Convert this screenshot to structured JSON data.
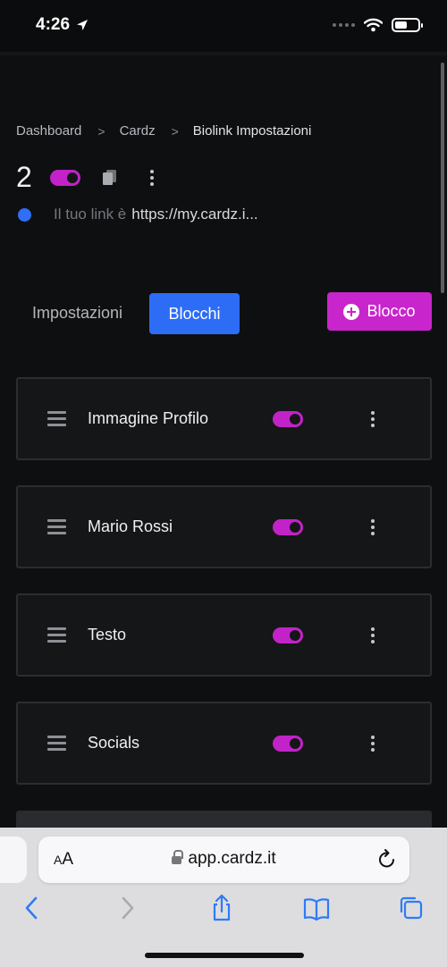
{
  "status_bar": {
    "time": "4:26"
  },
  "breadcrumb": {
    "items": [
      "Dashboard",
      "Cardz",
      "Biolink Impostazioni"
    ],
    "separator": ">"
  },
  "header": {
    "link_id": "2",
    "link_prefix": "Il tuo link è",
    "link_url": "https://my.cardz.i..."
  },
  "tabs": {
    "settings": "Impostazioni",
    "blocks": "Blocchi"
  },
  "add_block_label": "Blocco",
  "blocks": [
    {
      "title": "Immagine Profilo",
      "enabled": true
    },
    {
      "title": "Mario Rossi",
      "enabled": true
    },
    {
      "title": "Testo",
      "enabled": true
    },
    {
      "title": "Socials",
      "enabled": true
    }
  ],
  "browser": {
    "aa_label": "AA",
    "url": "app.cardz.it"
  },
  "colors": {
    "accent_magenta": "#c925cc",
    "primary_blue": "#2d6df6",
    "background": "#0e0f11"
  },
  "icons": [
    "location-arrow-icon",
    "wifi-icon",
    "battery-icon",
    "copy-icon",
    "kebab-icon",
    "plus-circle-icon",
    "drag-handle-icon",
    "lock-icon",
    "reload-icon",
    "back-icon",
    "forward-icon",
    "share-icon",
    "bookmarks-icon",
    "tabs-icon"
  ]
}
